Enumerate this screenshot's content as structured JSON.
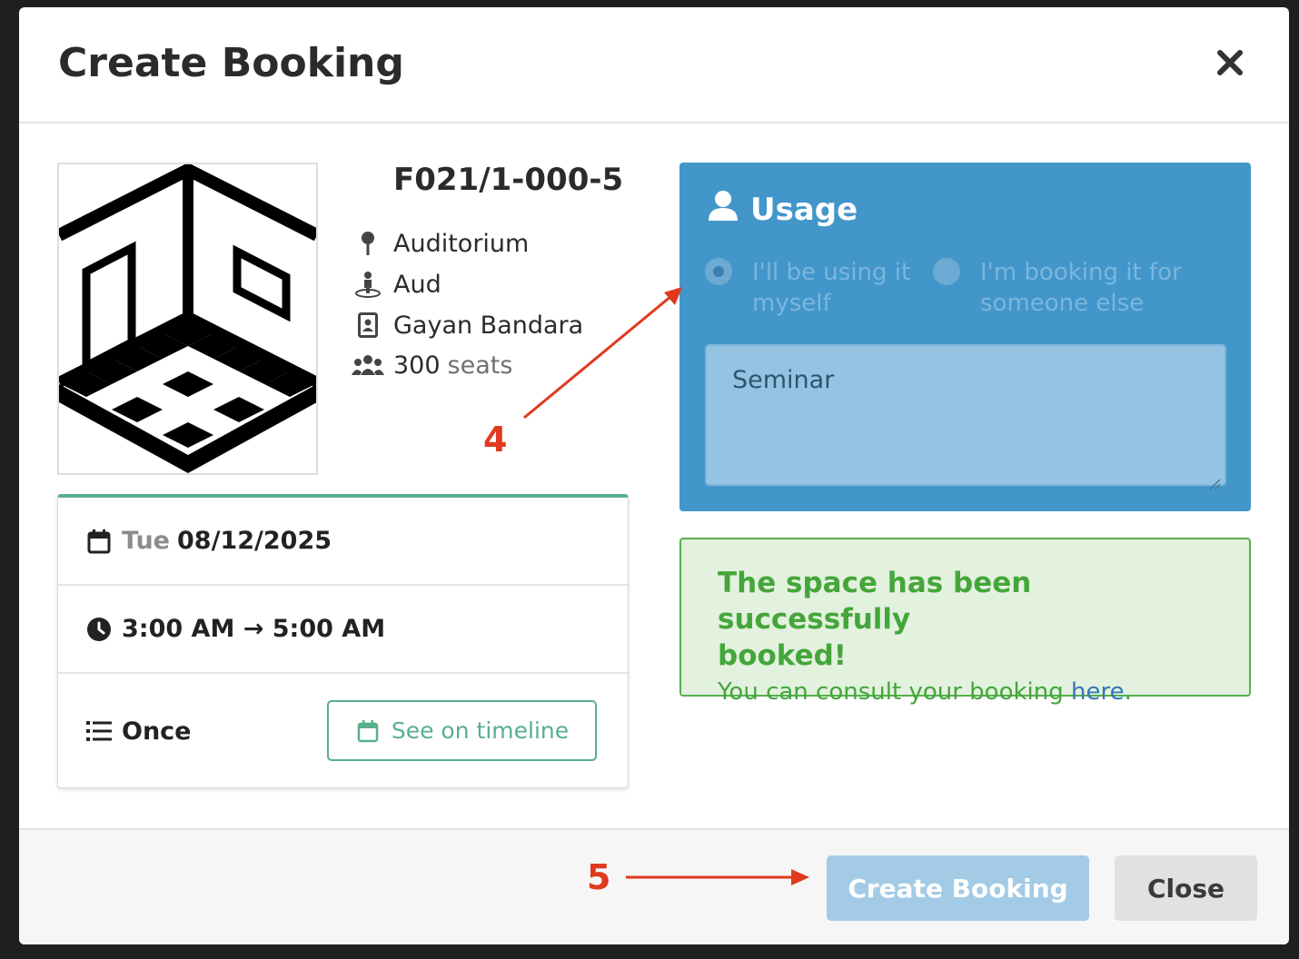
{
  "modal": {
    "title": "Create Booking"
  },
  "room": {
    "name": "F021/1-000-5",
    "type": "Auditorium",
    "code": "Aud",
    "manager": "Gayan Bandara",
    "capacity": "300",
    "capacity_unit": "seats"
  },
  "schedule": {
    "weekday": "Tue",
    "date": "08/12/2025",
    "time_range": "3:00 AM → 5:00 AM",
    "recurrence": "Once",
    "timeline_button": "See on timeline"
  },
  "usage": {
    "title": "Usage",
    "options": [
      {
        "label": "I'll be using it myself",
        "line1": "I'll be using it",
        "line2": "myself",
        "checked": true
      },
      {
        "label": "I'm booking it for someone else",
        "line1": "I'm booking it for",
        "line2": "someone else",
        "checked": false
      }
    ],
    "description": "Seminar"
  },
  "success": {
    "heading_line1": "The space has been successfully",
    "heading_line2": "booked!",
    "message": "You can consult your booking",
    "link": "here",
    "period": "."
  },
  "annotations": {
    "step4": "4",
    "step5": "5"
  },
  "footer": {
    "create_button": "Create Booking",
    "close_button": "Close"
  },
  "colors": {
    "accent_green": "#5aaf8c",
    "usage_blue": "#4296ca",
    "success_green": "#44a63a",
    "annotation_red": "#e0391e",
    "create_button_disabled": "#a3cbe6"
  }
}
